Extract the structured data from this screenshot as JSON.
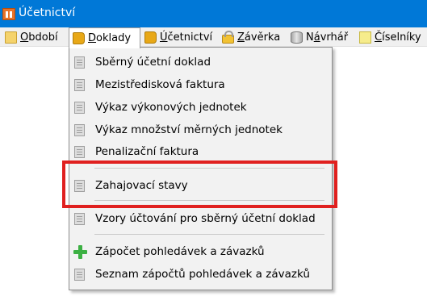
{
  "window": {
    "title": "Účetnictví"
  },
  "menubar": {
    "items": [
      {
        "id": "obdobi",
        "pre": "",
        "u": "O",
        "post": "bdobí",
        "icon": "folder-icon"
      },
      {
        "id": "doklady",
        "pre": "",
        "u": "D",
        "post": "oklady",
        "icon": "book-icon",
        "active": true
      },
      {
        "id": "ucetnictvi",
        "pre": "",
        "u": "Ú",
        "post": "četnictví",
        "icon": "book-icon"
      },
      {
        "id": "zaverka",
        "pre": "",
        "u": "Z",
        "post": "ávěrka",
        "icon": "lock-icon"
      },
      {
        "id": "navrhar",
        "pre": "N",
        "u": "á",
        "post": "vrhář",
        "icon": "cylinder-icon"
      },
      {
        "id": "ciselniky",
        "pre": "",
        "u": "Č",
        "post": "íselníky",
        "icon": "note-icon"
      }
    ]
  },
  "dropdown": {
    "items": [
      {
        "label": "Sběrný účetní doklad",
        "icon": "document-icon"
      },
      {
        "label": "Mezistředisková faktura",
        "icon": "document-icon"
      },
      {
        "label": "Výkaz výkonových jednotek",
        "icon": "document-icon"
      },
      {
        "label": "Výkaz množství měrných jednotek",
        "icon": "document-icon"
      },
      {
        "label": "Penalizační faktura",
        "icon": "document-icon"
      },
      {
        "label": "Zahajovací stavy",
        "icon": "document-icon"
      },
      {
        "label": "Vzory účtování pro sběrný účetní doklad",
        "icon": "document-icon"
      },
      {
        "label": "Zápočet pohledávek a závazků",
        "icon": "plus-icon"
      },
      {
        "label": "Seznam zápočtů pohledávek a závazků",
        "icon": "document-icon"
      }
    ]
  },
  "highlight": {
    "target": "Zahajovací stavy",
    "color": "#e0201f"
  },
  "colors": {
    "titlebar": "#0078d7",
    "menubar": "#f0f0f0",
    "menu_bg": "#f2f2f2",
    "plus": "#3cb043"
  }
}
